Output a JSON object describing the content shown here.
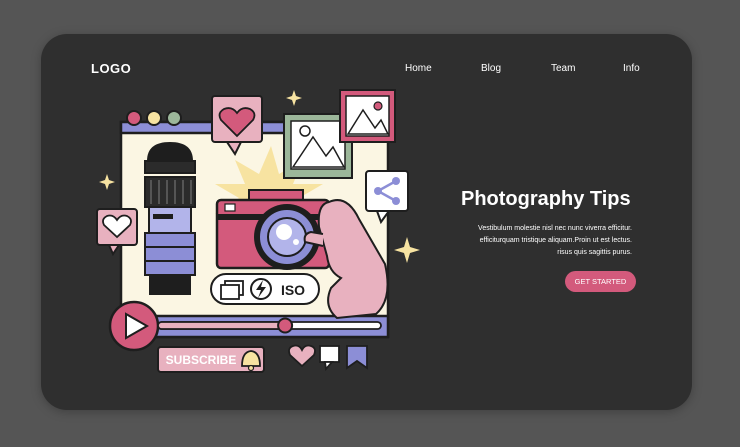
{
  "header": {
    "logo": "LOGO",
    "nav": [
      {
        "label": "Home"
      },
      {
        "label": "Blog"
      },
      {
        "label": "Team"
      },
      {
        "label": "Info"
      }
    ]
  },
  "hero": {
    "title": "Photography Tips",
    "body_lines": [
      "Vestibulum molestie nisl nec nunc viverra efficitur.",
      "efficiturquam tristique aliquam.Proin ut est lectus.",
      "risus quis sagittis purus."
    ],
    "cta_label": "GET STARTED"
  },
  "illustration": {
    "iso_label": "ISO",
    "subscribe_label": "SUBSCRIBE",
    "video_progress": 0.57
  },
  "colors": {
    "page_bg": "#555555",
    "card_bg": "#2f2f2f",
    "accent_pink": "#d35a7c",
    "lavender": "#8c8ed6",
    "cream": "#fbf6e3",
    "sage": "#9cb79a",
    "light_pink": "#e8b1bf",
    "sun_yellow": "#f7e3a1"
  }
}
